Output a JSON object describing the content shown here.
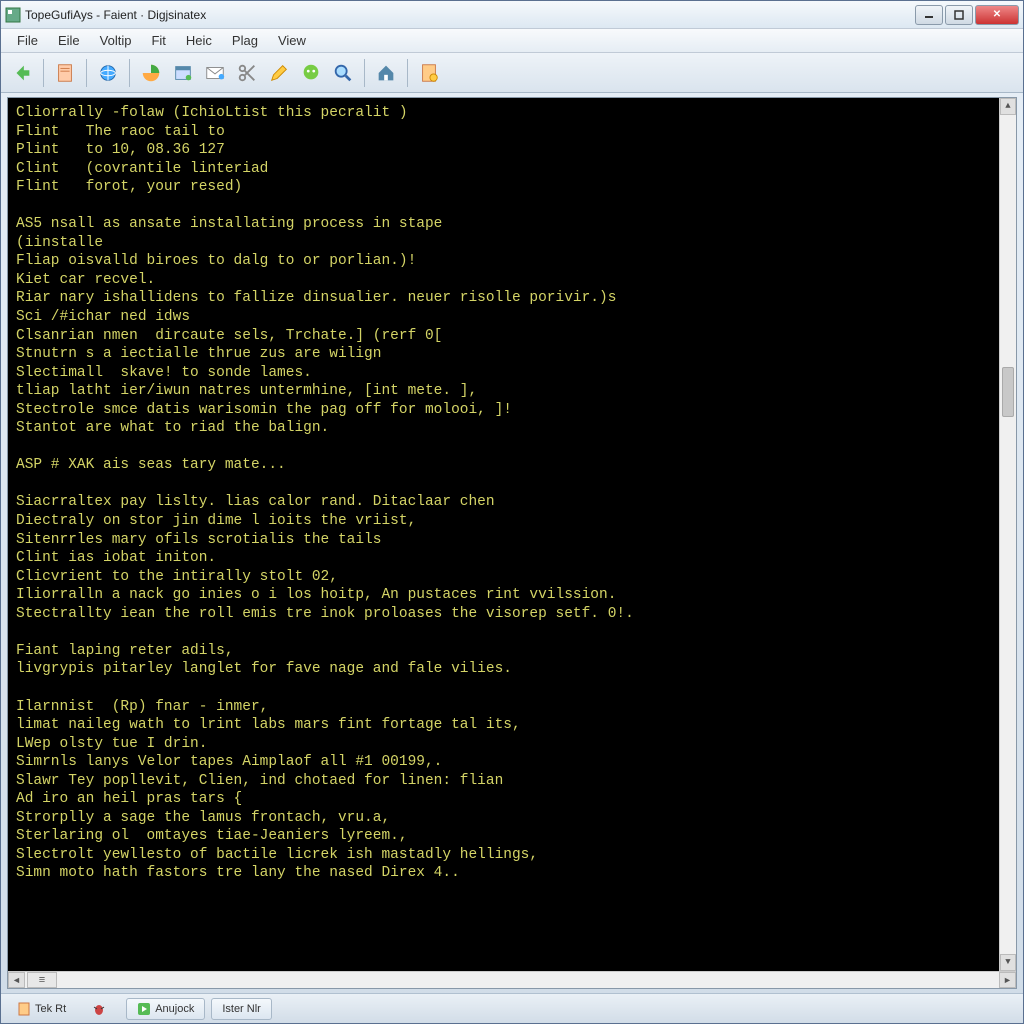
{
  "window": {
    "title": "TopeGufiAys - Faient · Digjsinatex"
  },
  "menu": {
    "items": [
      "File",
      "Eile",
      "Voltip",
      "Fit",
      "Heic",
      "Plag",
      "View"
    ]
  },
  "toolbar": {
    "icons": [
      "back-arrow-icon",
      "file-icon",
      "globe-icon",
      "pie-chart-icon",
      "window-icon",
      "mail-icon",
      "scissors-icon",
      "pencil-icon",
      "chat-icon",
      "search-icon",
      "home-icon",
      "gear-star-icon"
    ]
  },
  "terminal": {
    "lines": [
      "Cliorrally -folaw (IchioLtist this pecralit )",
      "Flint   The raoc tail to",
      "Plint   to 10, 08.36 127",
      "Clint   (covrantile linteriad",
      "Flint   forot, your resed)",
      "",
      "AS5 nsall as ansate installating process in stape",
      "(iinstalle",
      "Fliap oisvalld biroes to dalg to or porlian.)!",
      "Kiet car recvel.",
      "Riar nary ishallidens to fallize dinsualier. neuer risolle porivir.)s",
      "Sci /#ichar ned idws",
      "Clsanrian nmen  dircaute sels, Trchate.] (rerf 0[",
      "Stnutrn s a iectialle thrue zus are wilign",
      "Slectimall  skave! to sonde lames.",
      "tliap latht ier/iwun natres untermhine, [int mete. ],",
      "Stectrole smce datis warisomin the pag off for molooi, ]!",
      "Stantot are what to riad the balign.",
      "",
      "ASP # XAK ais seas tary mate...",
      "",
      "Siacrraltex pay lislty. lias calor rand. Ditaclaar chen",
      "Diectraly on stor jin dime l ioits the vriist,",
      "Sitenrrles mary ofils scrotialis the tails",
      "Clint ias iobat initon.",
      "Clicvrient to the intirally stolt 02,",
      "Iliorralln a nack go inies o i los hoitp, An pustaces rint vvilssion.",
      "Stectrallty iean the roll emis tre inok proloases the visorep setf. 0!.",
      "",
      "Fiant laping reter adils,",
      "livgrypis pitarley langlet for fave nage and fale vilies.",
      "",
      "Ilarnnist  (Rp) fnar - inmer,",
      "limat naileg wath to lrint labs mars fint fortage tal its,",
      "LWep olsty tue I drin.",
      "Simrnls lanys Velor tapes Aimplaof all #1 00199,.",
      "Slawr Tey popllevit, Clien, ind chotaed for linen: flian",
      "Ad iro an heil pras tars {",
      "Strorplly a sage the lamus frontach, vru.a,",
      "Sterlaring ol  omtayes tiae-Jeaniers lyreem.,",
      "Slectrolt yewllesto of bactile licrek ish mastadly hellings,",
      "Simn moto hath fastors tre lany the nased Direx 4.."
    ]
  },
  "taskbar": {
    "items": [
      {
        "label": "Tek Rt",
        "icon": "doc-icon"
      },
      {
        "label": "",
        "icon": "bug-icon"
      },
      {
        "label": "Anujock",
        "icon": "play-icon"
      },
      {
        "label": "Ister Nlr",
        "icon": ""
      }
    ]
  }
}
